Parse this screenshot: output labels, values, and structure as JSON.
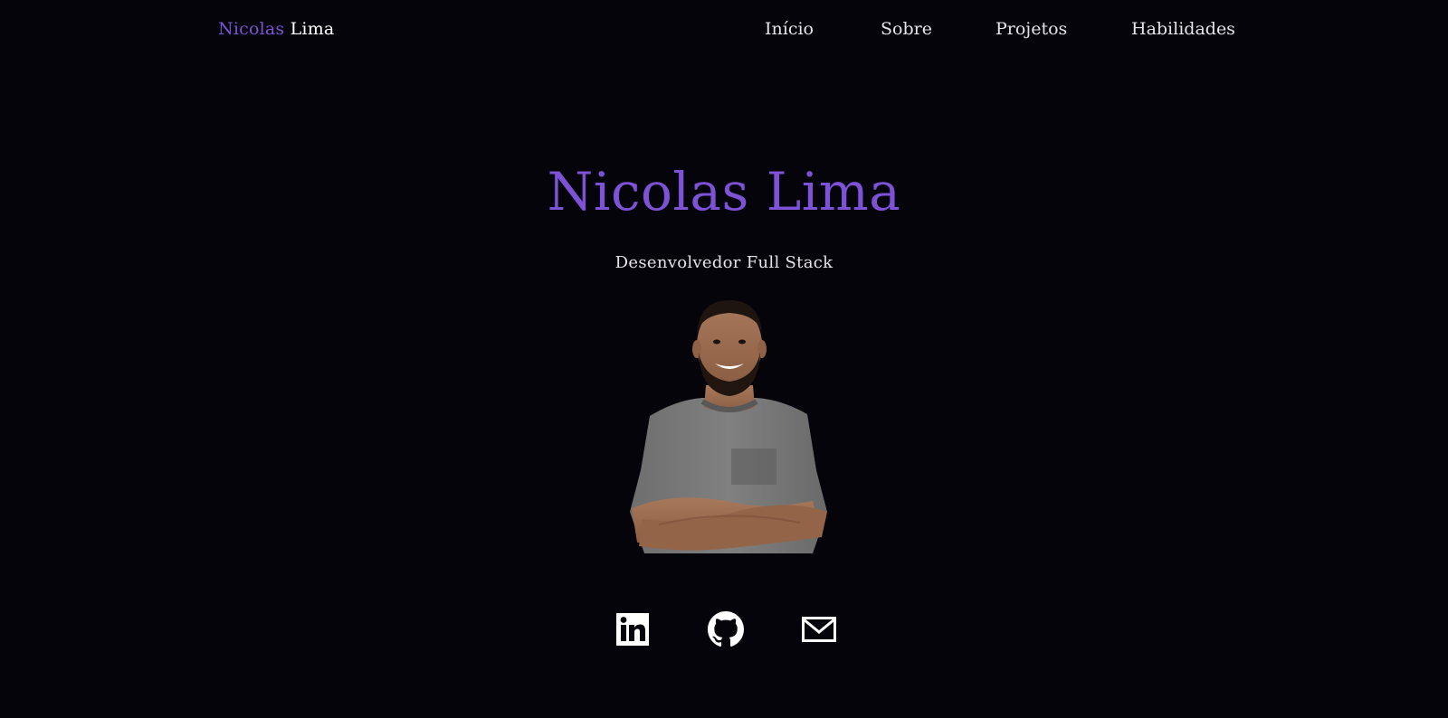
{
  "nav": {
    "logo_first": "Nicolas",
    "logo_last": "Lima",
    "links": [
      {
        "label": "Início"
      },
      {
        "label": "Sobre"
      },
      {
        "label": "Projetos"
      },
      {
        "label": "Habilidades"
      }
    ]
  },
  "hero": {
    "title": "Nicolas Lima",
    "subtitle": "Desenvolvedor Full Stack",
    "photo_alt": "profile-photo"
  },
  "socials": [
    {
      "icon": "linkedin-icon"
    },
    {
      "icon": "github-icon"
    },
    {
      "icon": "mail-icon"
    }
  ],
  "colors": {
    "background": "#05040a",
    "accent": "#7d52d6",
    "text": "#e6e4ea"
  }
}
